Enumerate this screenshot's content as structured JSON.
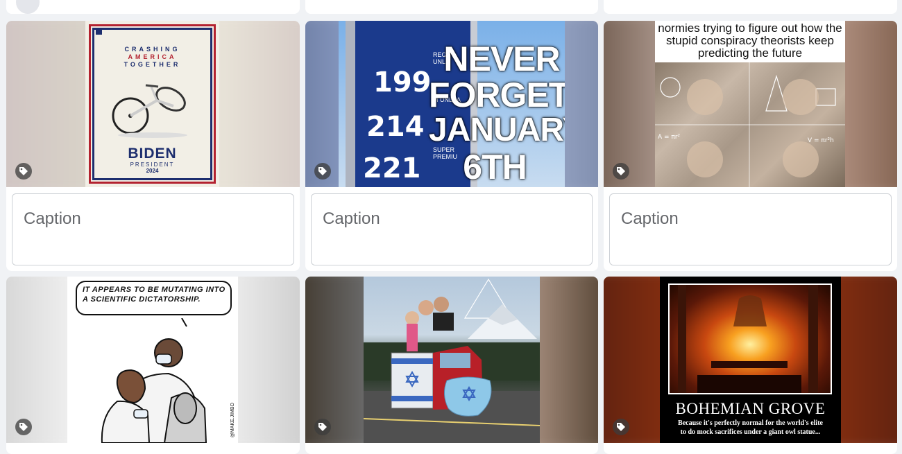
{
  "cards": [
    {
      "caption_placeholder": "Caption",
      "image": {
        "headline_1": "CRASHING",
        "headline_2": "AMERICA",
        "headline_3": "TOGETHER",
        "brand": "BIDEN",
        "subtitle": "PRESIDENT",
        "year": "2024"
      }
    },
    {
      "caption_placeholder": "Caption",
      "image": {
        "prices": [
          "199",
          "214",
          "221"
        ],
        "small_labels": [
          "REGU UNLE",
          "M UNLEA",
          "SUPER PREMIU"
        ],
        "line_1": "NEVER",
        "line_2": "FORGET",
        "line_3": "JANUARY",
        "line_4": "6TH"
      }
    },
    {
      "caption_placeholder": "Caption",
      "image": {
        "text": "normies trying to figure out how the stupid conspiracy theorists keep predicting the future"
      }
    },
    {
      "image": {
        "speech": "IT APPEARS TO BE MUTATING INTO A SCIENTIFIC DICTATORSHIP.",
        "signature": "@MAKE.JIMBO"
      }
    },
    {
      "image": {}
    },
    {
      "image": {
        "title": "BOHEMIAN GROVE",
        "subtitle": "Because it's perfectly normal for the world's elite to do mock sacrifices under a giant owl statue..."
      }
    }
  ],
  "colors": {
    "page_bg": "#f0f2f5",
    "card_bg": "#ffffff",
    "caption_text": "#65676b",
    "tag_icon_bg": "#3c3c3c"
  },
  "icons": [
    "tag-icon"
  ]
}
